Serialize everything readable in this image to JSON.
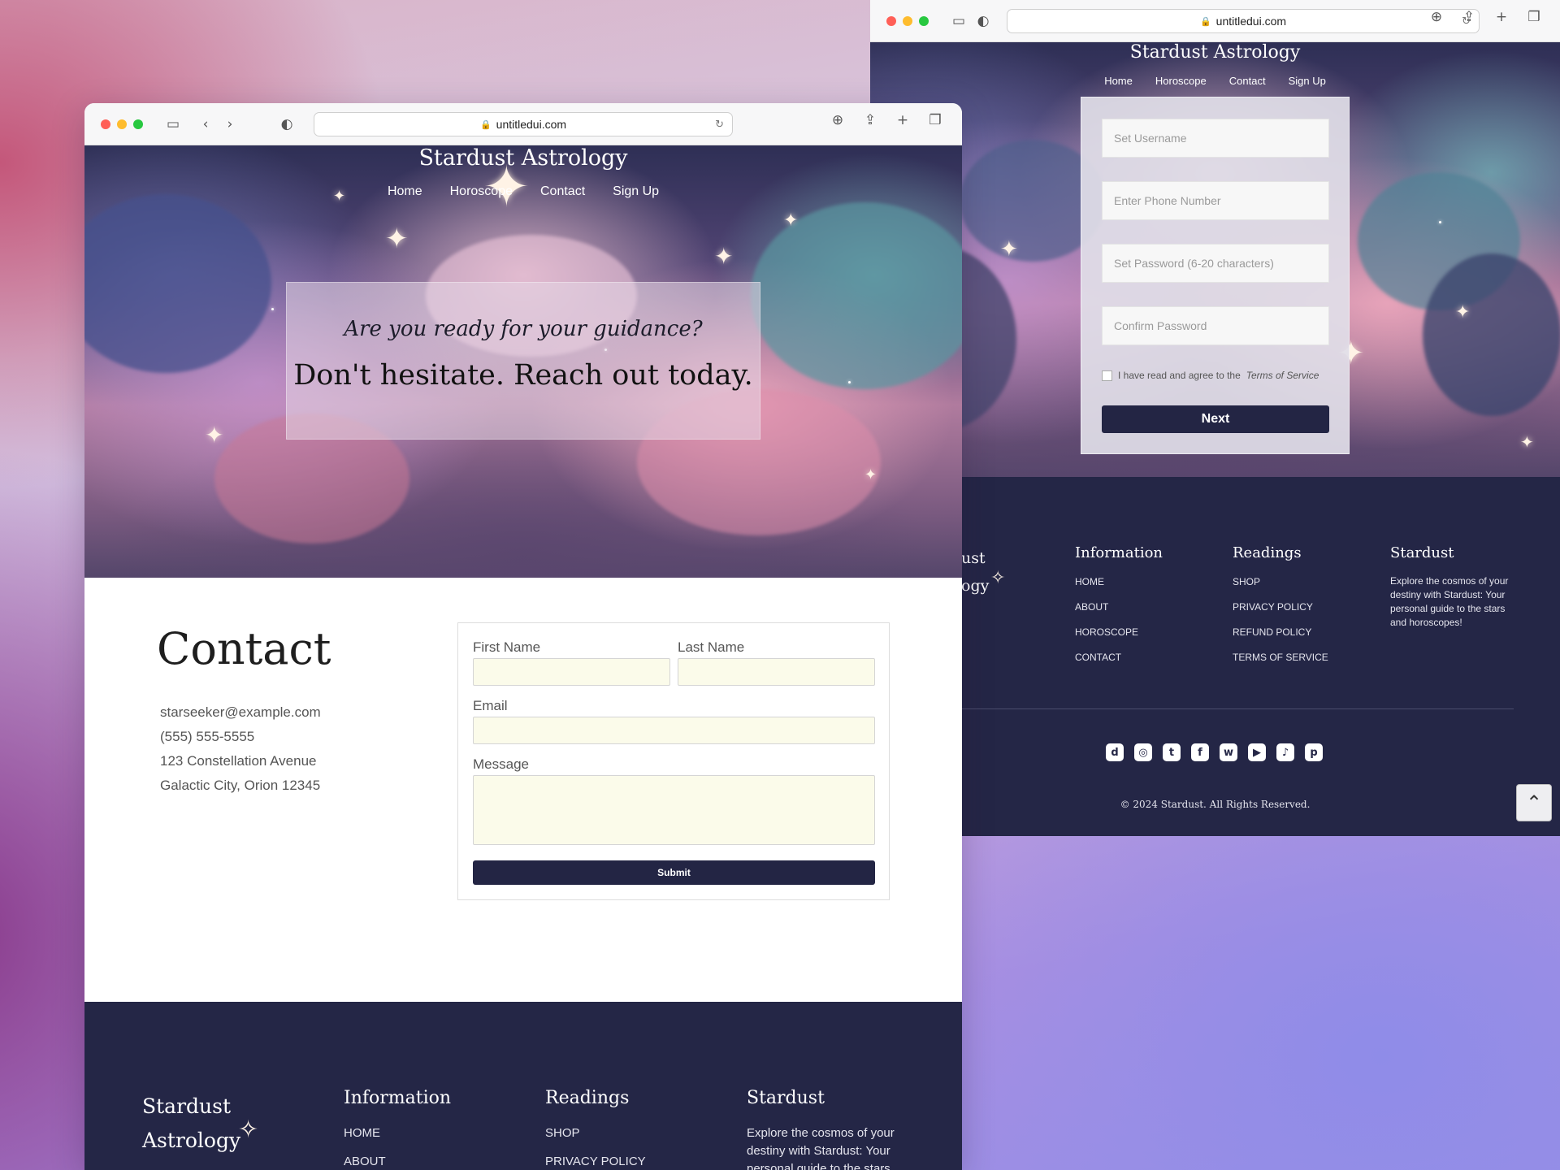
{
  "back_window": {
    "url": "untitledui.com",
    "brand": "Stardust Astrology",
    "nav": [
      "Home",
      "Horoscope",
      "Contact",
      "Sign Up"
    ],
    "signup": {
      "username_placeholder": "Set Username",
      "phone_placeholder": "Enter Phone Number",
      "password_placeholder": "Set Password (6-20 characters)",
      "confirm_placeholder": "Confirm Password",
      "agree_text": "I have read and agree to the",
      "terms_link": "Terms of Service",
      "next_label": "Next"
    },
    "footer": {
      "brand_line1": "ust",
      "brand_line2": "ogy",
      "info_heading": "Information",
      "info_links": [
        "HOME",
        "ABOUT",
        "HOROSCOPE",
        "CONTACT"
      ],
      "readings_heading": "Readings",
      "readings_links": [
        "SHOP",
        "PRIVACY POLICY",
        "REFUND POLICY",
        "TERMS OF SERVICE"
      ],
      "about_heading": "Stardust",
      "about_text": "Explore the cosmos of your destiny with Stardust: Your personal guide to the stars and horoscopes!",
      "copyright": "© 2024 Stardust. All Rights Reserved.",
      "social_icons": [
        "discord-icon",
        "instagram-icon",
        "twitter-icon",
        "facebook-icon",
        "whatsapp-icon",
        "youtube-icon",
        "tiktok-icon",
        "pinterest-icon"
      ]
    }
  },
  "front_window": {
    "url": "untitledui.com",
    "brand": "Stardust Astrology",
    "nav": [
      "Home",
      "Horoscope",
      "Contact",
      "Sign Up"
    ],
    "hero": {
      "question": "Are you ready for your guidance?",
      "tagline": "Don't hesitate. Reach out today."
    },
    "contact": {
      "title": "Contact",
      "email": "starseeker@example.com",
      "phone": "(555) 555-5555",
      "address1": "123 Constellation Avenue",
      "address2": "Galactic City, Orion 12345",
      "first_name_label": "First Name",
      "last_name_label": "Last Name",
      "email_label": "Email",
      "message_label": "Message",
      "submit_label": "Submit"
    },
    "footer": {
      "brand_line1": "Stardust",
      "brand_line2": "Astrology",
      "info_heading": "Information",
      "info_links": [
        "HOME",
        "ABOUT"
      ],
      "readings_heading": "Readings",
      "readings_links": [
        "SHOP",
        "PRIVACY POLICY"
      ],
      "about_heading": "Stardust",
      "about_text": "Explore the cosmos of your destiny with Stardust: Your personal guide to the stars and horoscopes!"
    }
  },
  "colors": {
    "navy": "#242646",
    "button": "#232544",
    "input_bg": "#fbfbea"
  }
}
